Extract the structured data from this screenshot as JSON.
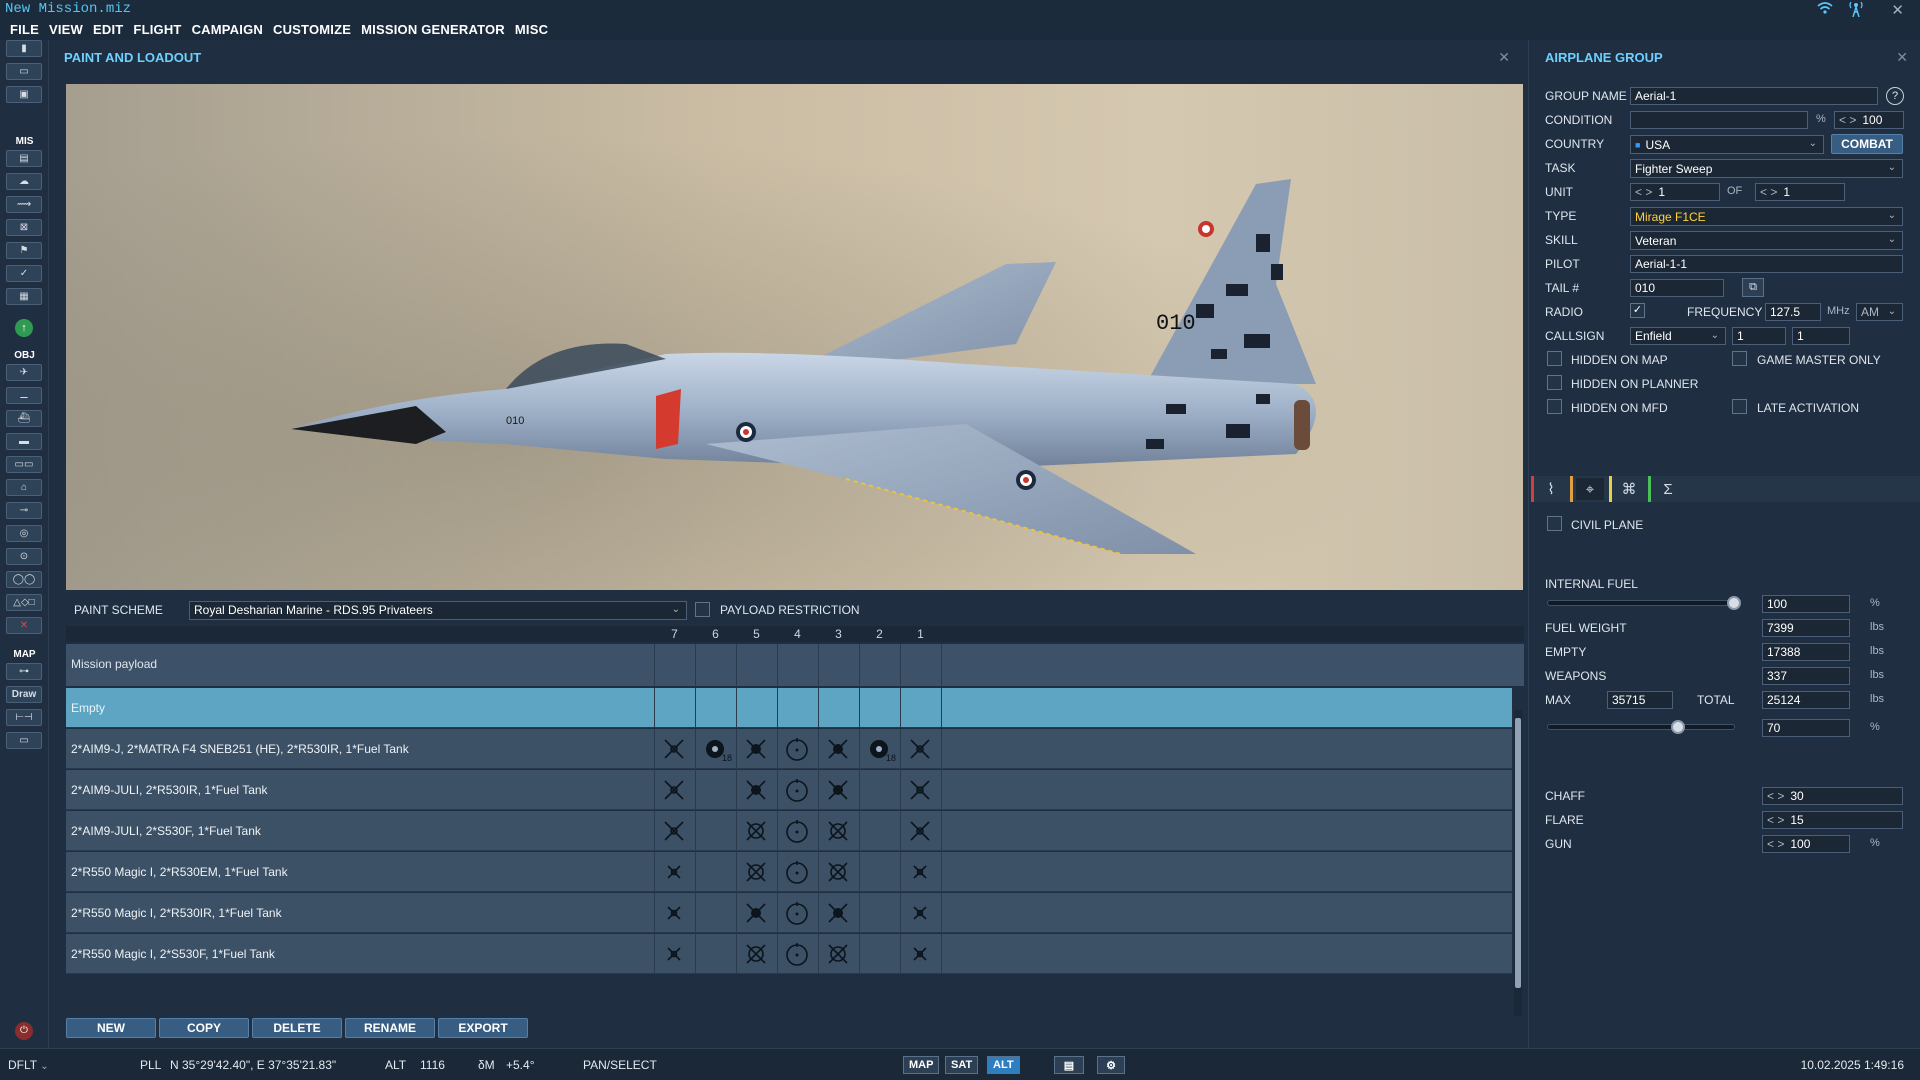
{
  "window": {
    "title": "New Mission.miz"
  },
  "menu": [
    "FILE",
    "VIEW",
    "EDIT",
    "FLIGHT",
    "CAMPAIGN",
    "CUSTOMIZE",
    "MISSION GENERATOR",
    "MISC"
  ],
  "left_toolbar": {
    "sections": {
      "mis": "MIS",
      "obj": "OBJ",
      "map": "MAP"
    },
    "draw": "Draw"
  },
  "paint_panel": {
    "title": "PAINT AND LOADOUT",
    "aircraft_markings": {
      "tail_code": "010",
      "nose_code": "010"
    },
    "paint_scheme_label": "PAINT SCHEME",
    "paint_scheme": "Royal Desharian Marine - RDS.95 Privateers",
    "payload_restriction_label": "PAYLOAD RESTRICTION",
    "pylons": [
      "7",
      "6",
      "5",
      "4",
      "3",
      "2",
      "1"
    ],
    "mission_payload_label": "Mission payload",
    "loadouts": [
      {
        "name": "Empty",
        "selected": true
      },
      {
        "name": "2*AIM9-J, 2*MATRA F4 SNEB251 (HE), 2*R530IR, 1*Fuel Tank",
        "selected": false,
        "rocket_count": "18"
      },
      {
        "name": "2*AIM9-JULI, 2*R530IR, 1*Fuel Tank",
        "selected": false
      },
      {
        "name": "2*AIM9-JULI, 2*S530F, 1*Fuel Tank",
        "selected": false
      },
      {
        "name": "2*R550 Magic I, 2*R530EM, 1*Fuel Tank",
        "selected": false
      },
      {
        "name": "2*R550 Magic I, 2*R530IR, 1*Fuel Tank",
        "selected": false
      },
      {
        "name": "2*R550 Magic I, 2*S530F, 1*Fuel Tank",
        "selected": false
      }
    ],
    "buttons": {
      "new": "NEW",
      "copy": "COPY",
      "delete": "DELETE",
      "rename": "RENAME",
      "export": "EXPORT"
    }
  },
  "group_panel": {
    "title": "AIRPLANE GROUP",
    "group_name_label": "GROUP NAME",
    "group_name": "Aerial-1",
    "condition_label": "CONDITION",
    "condition_unit": "%",
    "condition_value": "100",
    "country_label": "COUNTRY",
    "country": "USA",
    "combat_button": "COMBAT",
    "task_label": "TASK",
    "task": "Fighter Sweep",
    "unit_label": "UNIT",
    "unit": "1",
    "of_label": "OF",
    "unit_of": "1",
    "type_label": "TYPE",
    "type": "Mirage F1CE",
    "skill_label": "SKILL",
    "skill": "Veteran",
    "pilot_label": "PILOT",
    "pilot": "Aerial-1-1",
    "tail_label": "TAIL #",
    "tail": "010",
    "radio_label": "RADIO",
    "radio_checked": true,
    "frequency_label": "FREQUENCY",
    "frequency": "127.5",
    "freq_unit": "MHz",
    "modulation": "AM",
    "callsign_label": "CALLSIGN",
    "callsign": "Enfield",
    "callsign_n1": "1",
    "callsign_n2": "1",
    "checks": {
      "hidden_on_map": "HIDDEN ON MAP",
      "game_master_only": "GAME MASTER ONLY",
      "hidden_on_planner": "HIDDEN ON PLANNER",
      "hidden_on_mfd": "HIDDEN ON MFD",
      "late_activation": "LATE ACTIVATION"
    },
    "civil_plane_label": "CIVIL PLANE",
    "internal_fuel_label": "INTERNAL FUEL",
    "internal_fuel": "100",
    "internal_fuel_fraction": 1.0,
    "fuel_weight_label": "FUEL WEIGHT",
    "fuel_weight": "7399",
    "empty_label": "EMPTY",
    "empty": "17388",
    "weapons_label": "WEAPONS",
    "weapons": "337",
    "max_label": "MAX",
    "max": "35715",
    "total_label": "TOTAL",
    "total": "25124",
    "load_percent": "70",
    "load_fraction": 0.7,
    "lbs": "lbs",
    "pct": "%",
    "chaff_label": "CHAFF",
    "chaff": "30",
    "flare_label": "FLARE",
    "flare": "15",
    "gun_label": "GUN",
    "gun": "100"
  },
  "status": {
    "profile": "DFLT",
    "coord_label": "PLL",
    "coords": "N 35°29'42.40\", E 37°35'21.83\"",
    "alt_label": "ALT",
    "alt": "1116",
    "dm_label": "δM",
    "dm": "+5.4°",
    "mode": "PAN/SELECT",
    "map_btn": "MAP",
    "sat_btn": "SAT",
    "alt_btn": "ALT",
    "datetime": "10.02.2025 1:49:16"
  },
  "colors": {
    "accent": "#6dd0ff",
    "selected_row": "#5da5c2",
    "type_text": "#ffd23a",
    "close_red": "#c0392b"
  }
}
